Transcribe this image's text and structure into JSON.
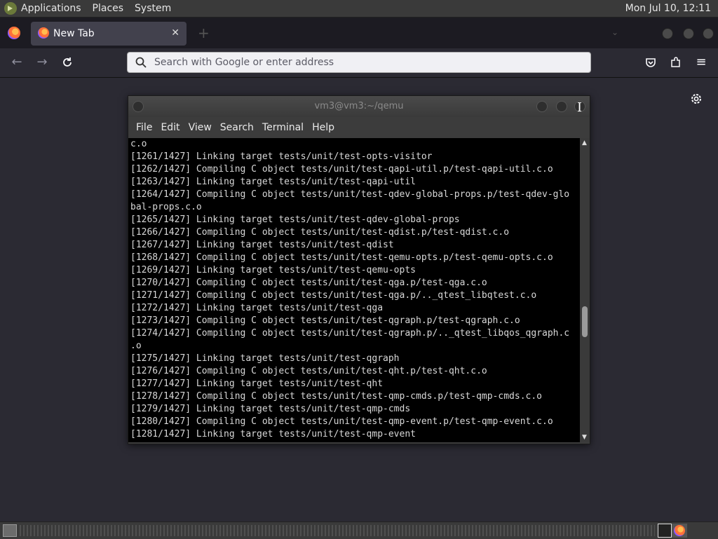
{
  "top_panel": {
    "menus": [
      "Applications",
      "Places",
      "System"
    ],
    "clock": "Mon Jul 10, 12:11"
  },
  "browser": {
    "tab_label": "New Tab",
    "urlbar_placeholder": "Search with Google or enter address",
    "accent": "#fbfbfe"
  },
  "terminal": {
    "title": "vm3@vm3:~/qemu",
    "menus": [
      "File",
      "Edit",
      "View",
      "Search",
      "Terminal",
      "Help"
    ],
    "lines": [
      "c.o",
      "[1261/1427] Linking target tests/unit/test-opts-visitor",
      "[1262/1427] Compiling C object tests/unit/test-qapi-util.p/test-qapi-util.c.o",
      "[1263/1427] Linking target tests/unit/test-qapi-util",
      "[1264/1427] Compiling C object tests/unit/test-qdev-global-props.p/test-qdev-glo",
      "bal-props.c.o",
      "[1265/1427] Linking target tests/unit/test-qdev-global-props",
      "[1266/1427] Compiling C object tests/unit/test-qdist.p/test-qdist.c.o",
      "[1267/1427] Linking target tests/unit/test-qdist",
      "[1268/1427] Compiling C object tests/unit/test-qemu-opts.p/test-qemu-opts.c.o",
      "[1269/1427] Linking target tests/unit/test-qemu-opts",
      "[1270/1427] Compiling C object tests/unit/test-qga.p/test-qga.c.o",
      "[1271/1427] Compiling C object tests/unit/test-qga.p/.._qtest_libqtest.c.o",
      "[1272/1427] Linking target tests/unit/test-qga",
      "[1273/1427] Compiling C object tests/unit/test-qgraph.p/test-qgraph.c.o",
      "[1274/1427] Compiling C object tests/unit/test-qgraph.p/.._qtest_libqos_qgraph.c",
      ".o",
      "[1275/1427] Linking target tests/unit/test-qgraph",
      "[1276/1427] Compiling C object tests/unit/test-qht.p/test-qht.c.o",
      "[1277/1427] Linking target tests/unit/test-qht",
      "[1278/1427] Compiling C object tests/unit/test-qmp-cmds.p/test-qmp-cmds.c.o",
      "[1279/1427] Linking target tests/unit/test-qmp-cmds",
      "[1280/1427] Compiling C object tests/unit/test-qmp-event.p/test-qmp-event.c.o",
      "[1281/1427] Linking target tests/unit/test-qmp-event"
    ]
  }
}
